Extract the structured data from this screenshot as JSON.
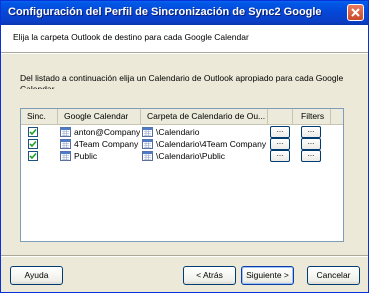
{
  "window": {
    "title": "Configuración del Perfil de Sincronización de Sync2 Google"
  },
  "header": {
    "caption": "Elija la carpeta Outlook de destino para cada Google Calendar"
  },
  "description": "Del listado a continuación elija un Calendario de Outlook apropiado para cada Google Calendar",
  "table": {
    "columns": [
      "Sinc.",
      "Google Calendar",
      "Carpeta de Calendario de Ou...",
      "",
      "Filters"
    ],
    "rows": [
      {
        "checked": true,
        "google": "anton@Company",
        "folder": "\\Calendario",
        "browse_label": "...",
        "filter_label": "..."
      },
      {
        "checked": true,
        "google": "4Team Company",
        "folder": "\\Calendario\\4Team Company",
        "browse_label": "...",
        "filter_label": "..."
      },
      {
        "checked": true,
        "google": "Public",
        "folder": "\\Calendario\\Public",
        "browse_label": "...",
        "filter_label": "..."
      }
    ]
  },
  "buttons": {
    "help": "Ayuda",
    "back": "< Atrás",
    "next": "Siguiente >",
    "cancel": "Cancelar"
  },
  "colors": {
    "titlebar": "#0a3fc7",
    "window_bg": "#ece9d8",
    "check": "#21a121"
  },
  "icons": {
    "close": "close-icon",
    "calendar": "calendar-icon",
    "check": "check-icon"
  }
}
